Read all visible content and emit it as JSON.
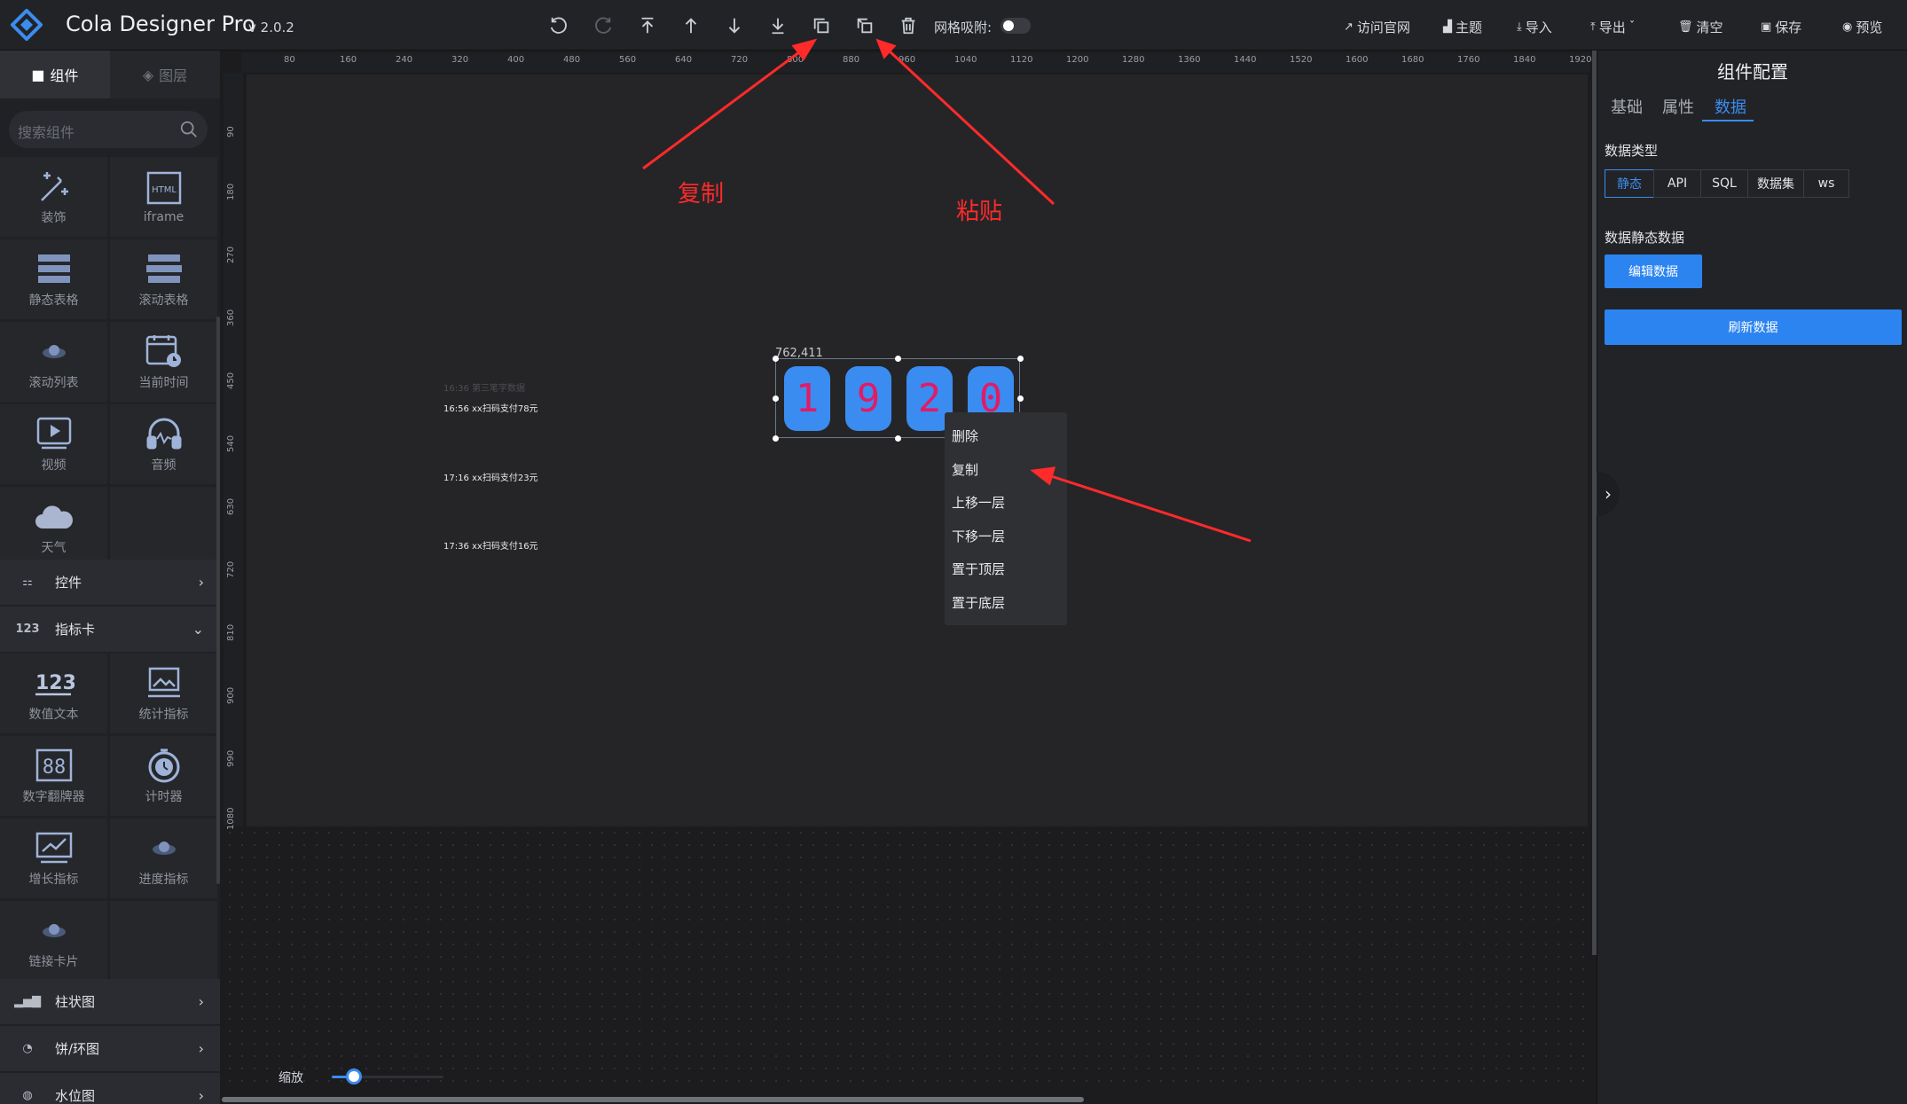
{
  "header": {
    "title": "Cola Designer Pro",
    "version": "v 2.0.2",
    "grid_snap_label": "网格吸附:",
    "links": {
      "visit_site": "访问官网",
      "theme": "主题",
      "import": "导入",
      "export": "导出",
      "clear": "清空",
      "save": "保存",
      "preview": "预览"
    }
  },
  "left_panel": {
    "tabs": {
      "components": "组件",
      "layers": "图层"
    },
    "search_placeholder": "搜索组件",
    "items_basic": [
      {
        "label": "装饰",
        "icon": "sparkle-wand-icon"
      },
      {
        "label": "iframe",
        "icon": "html-frame-icon"
      },
      {
        "label": "静态表格",
        "icon": "static-table-icon"
      },
      {
        "label": "滚动表格",
        "icon": "scroll-table-icon"
      },
      {
        "label": "滚动列表",
        "icon": "scroll-list-icon"
      },
      {
        "label": "当前时间",
        "icon": "calendar-clock-icon"
      },
      {
        "label": "视频",
        "icon": "video-play-icon"
      },
      {
        "label": "音频",
        "icon": "headphones-icon"
      },
      {
        "label": "天气",
        "icon": "cloud-icon"
      }
    ],
    "categories": {
      "controls": "控件",
      "indicator_cards": "指标卡",
      "bar_chart": "柱状图",
      "pie_chart": "饼/环图",
      "water_chart": "水位图"
    },
    "items_indicator": [
      {
        "label": "数值文本",
        "icon": "number-text-icon"
      },
      {
        "label": "统计指标",
        "icon": "image-frame-icon"
      },
      {
        "label": "数字翻牌器",
        "icon": "flip-digits-icon"
      },
      {
        "label": "计时器",
        "icon": "timer-icon"
      },
      {
        "label": "增长指标",
        "icon": "growth-chart-icon"
      },
      {
        "label": "进度指标",
        "icon": "progress-icon"
      },
      {
        "label": "链接卡片",
        "icon": "link-card-icon"
      }
    ]
  },
  "canvas": {
    "ruler_top": [
      "80",
      "160",
      "240",
      "320",
      "400",
      "480",
      "560",
      "640",
      "720",
      "800",
      "880",
      "960",
      "1040",
      "1120",
      "1200",
      "1280",
      "1360",
      "1440",
      "1520",
      "1600",
      "1680",
      "1760",
      "1840",
      "1920"
    ],
    "ruler_left": [
      "90",
      "180",
      "270",
      "360",
      "450",
      "540",
      "630",
      "720",
      "810",
      "900",
      "990",
      "1080"
    ],
    "list_lines": [
      "16:36 第三笔字数据",
      "16:56 xx扫码支付78元",
      "17:16 xx扫码支付23元",
      "17:36 xx扫码支付16元"
    ],
    "selection_coord": "762,411",
    "digits": [
      "1",
      "9",
      "2",
      "0"
    ],
    "context_menu": [
      "删除",
      "复制",
      "上移一层",
      "下移一层",
      "置于顶层",
      "置于底层"
    ],
    "annotations": {
      "copy": "复制",
      "paste": "粘贴"
    },
    "zoom_label": "缩放",
    "zoom_level": 0.2
  },
  "right_panel": {
    "title": "组件配置",
    "tabs": [
      "基础",
      "属性",
      "数据"
    ],
    "active_tab": "数据",
    "data_type_label": "数据类型",
    "data_types": [
      "静态",
      "API",
      "SQL",
      "数据集",
      "ws"
    ],
    "static_data_label": "数据静态数据",
    "edit_button": "编辑数据",
    "refresh_button": "刷新数据"
  },
  "colors": {
    "accent": "#2c84f0",
    "digit_bg": "#3b8cf0",
    "digit_text": "#e11b66",
    "annotation_red": "#ff2a2a"
  }
}
